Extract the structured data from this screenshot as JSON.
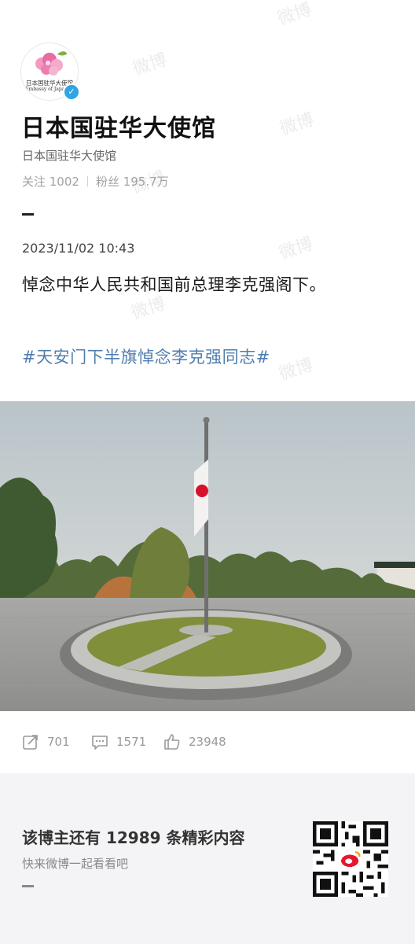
{
  "profile": {
    "avatar_text": "日本国驻华大使馆",
    "avatar_text_en": "Embassy of Japan in",
    "name": "日本国驻华大使馆",
    "subname": "日本国驻华大使馆",
    "following": "关注 1002",
    "followers": "粉丝 195.7万"
  },
  "post": {
    "date": "2023/11/02 10:43",
    "text": "悼念中华人民共和国前总理李克强阁下。",
    "hashtag": "#天安门下半旗悼念李克强同志#"
  },
  "actions": {
    "reposts": "701",
    "comments": "1571",
    "likes": "23948"
  },
  "footer": {
    "title": "该博主还有 12989 条精彩内容",
    "subtitle": "快来微博一起看看吧"
  },
  "watermark": "微博",
  "colors": {
    "link": "#507daf",
    "verify": "#2fa5e6",
    "footer_bg": "#f4f4f6"
  }
}
